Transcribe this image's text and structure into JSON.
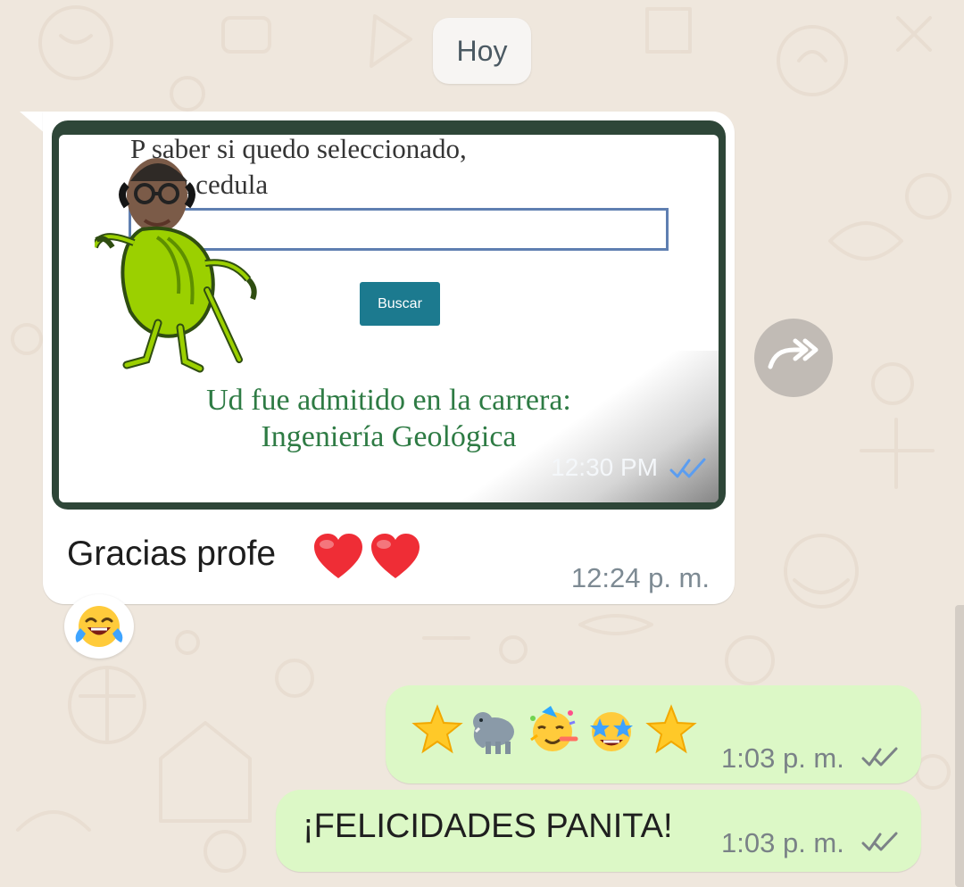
{
  "conversation": {
    "date_separator": "Hoy",
    "incoming_message": {
      "image": {
        "form_prompt_line_1": "P saber si quedo seleccionado,",
        "form_prompt_line_2": "i e su cedula",
        "search_button": "Buscar",
        "result_line_1": "Ud fue admitido en la carrera:",
        "result_line_2": "Ingeniería Geológica",
        "overlay_time": "12:30 PM"
      },
      "caption": "Gracias profe",
      "caption_emoji": [
        "heart-icon",
        "heart-icon"
      ],
      "time": "12:24 p. m.",
      "reaction": "laughing-tears-emoji"
    },
    "outgoing_messages": [
      {
        "emoji_sequence": [
          "star-emoji",
          "elephant-emoji",
          "party-face-emoji",
          "star-struck-emoji",
          "star-emoji"
        ],
        "time": "1:03 p. m."
      },
      {
        "text": "¡FELICIDADES PANITA!",
        "time": "1:03 p. m."
      }
    ],
    "forward_action": "forward-icon"
  },
  "colors": {
    "chat_background": "#efe7dd",
    "incoming_bubble": "#ffffff",
    "outgoing_bubble": "#dcf8c6",
    "read_receipt_overlay": "#5b9df0"
  }
}
